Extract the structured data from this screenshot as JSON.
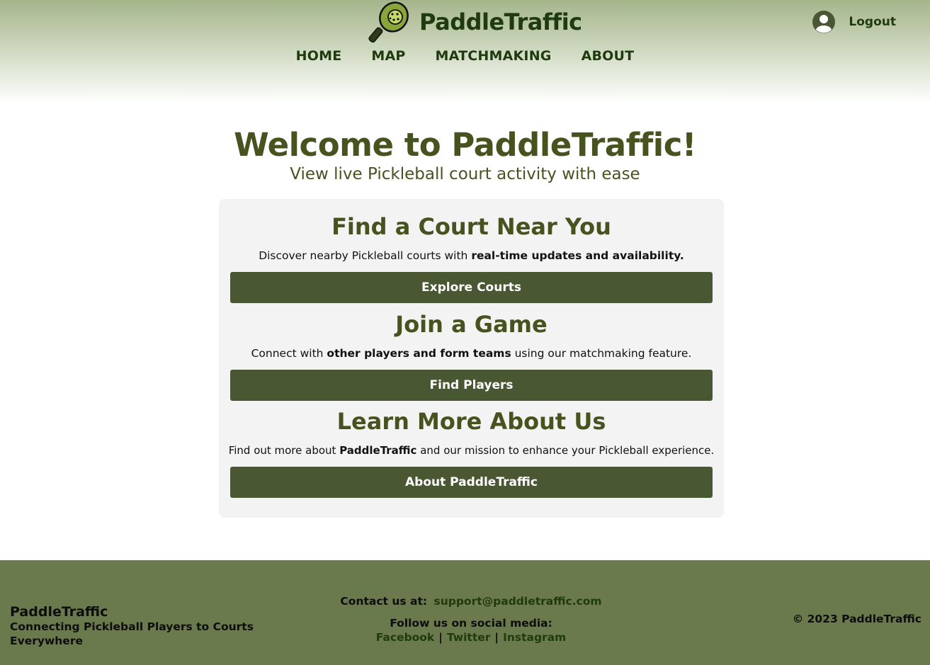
{
  "header": {
    "brand": "PaddleTraffic",
    "nav": [
      "HOME",
      "MAP",
      "MATCHMAKING",
      "ABOUT"
    ],
    "logout": "Logout"
  },
  "hero": {
    "title": "Welcome to PaddleTraffic!",
    "subtitle": "View live Pickleball court activity with ease"
  },
  "sections": [
    {
      "title": "Find a Court Near You",
      "text_plain": "Discover nearby Pickleball courts with ",
      "text_bold": "real-time updates and availability.",
      "text_after": "",
      "button": "Explore Courts"
    },
    {
      "title": "Join a Game",
      "text_plain": "Connect with ",
      "text_bold": "other players and form teams",
      "text_after": " using our matchmaking feature.",
      "button": "Find Players"
    },
    {
      "title": "Learn More About Us",
      "text_plain": "Find out more about ",
      "text_bold": "PaddleTraffic",
      "text_after": " and our mission to enhance your Pickleball experience.",
      "button": "About PaddleTraffic"
    }
  ],
  "footer": {
    "brand": "PaddleTraffic",
    "tagline": "Connecting Pickleball Players to Courts Everywhere",
    "contact_label": "Contact us at:",
    "contact_email": "support@paddletraffic.com",
    "follow_label": "Follow us on social media:",
    "social": [
      "Facebook",
      "Twitter",
      "Instagram"
    ],
    "separator": "|",
    "copyright": "© 2023 PaddleTraffic"
  },
  "colors": {
    "primary_dark": "#1f3a0e",
    "olive": "#47531f",
    "button": "#4a5733",
    "footer_bg": "#6b7a4c",
    "card_bg": "#f3f3f3"
  },
  "icons": {
    "logo": "pickleball-paddle-icon",
    "avatar": "user-avatar-icon"
  }
}
